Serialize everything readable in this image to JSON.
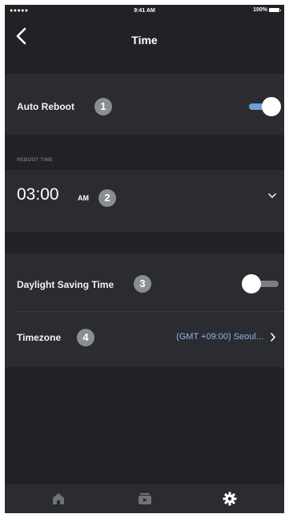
{
  "status_bar": {
    "signal": "●●●●● ",
    "time": "9:41 AM",
    "battery_percent": "100%"
  },
  "navbar": {
    "title": "Time",
    "back_icon": "chevron-left-icon"
  },
  "auto_reboot": {
    "label": "Auto Reboot",
    "badge": "1",
    "enabled": true
  },
  "reboot_time": {
    "section_header": "REBOOT TIME",
    "value": "03:00",
    "ampm": "AM",
    "badge": "2",
    "dropdown_icon": "chevron-down-icon"
  },
  "daylight_saving": {
    "label": "Daylight Saving Time",
    "badge": "3",
    "enabled": false
  },
  "timezone": {
    "label": "Timezone",
    "badge": "4",
    "value": "(GMT +09:00) Seoul...",
    "chevron_icon": "chevron-right-icon"
  },
  "tabbar": {
    "tabs": [
      {
        "icon": "home-icon",
        "active": false
      },
      {
        "icon": "media-icon",
        "active": false
      },
      {
        "icon": "gear-icon",
        "active": true
      }
    ]
  },
  "colors": {
    "background": "#202226",
    "row": "#2a2c31",
    "accent": "#6e9fd6",
    "link": "#8fb4e0",
    "badge": "#8a8d92"
  }
}
